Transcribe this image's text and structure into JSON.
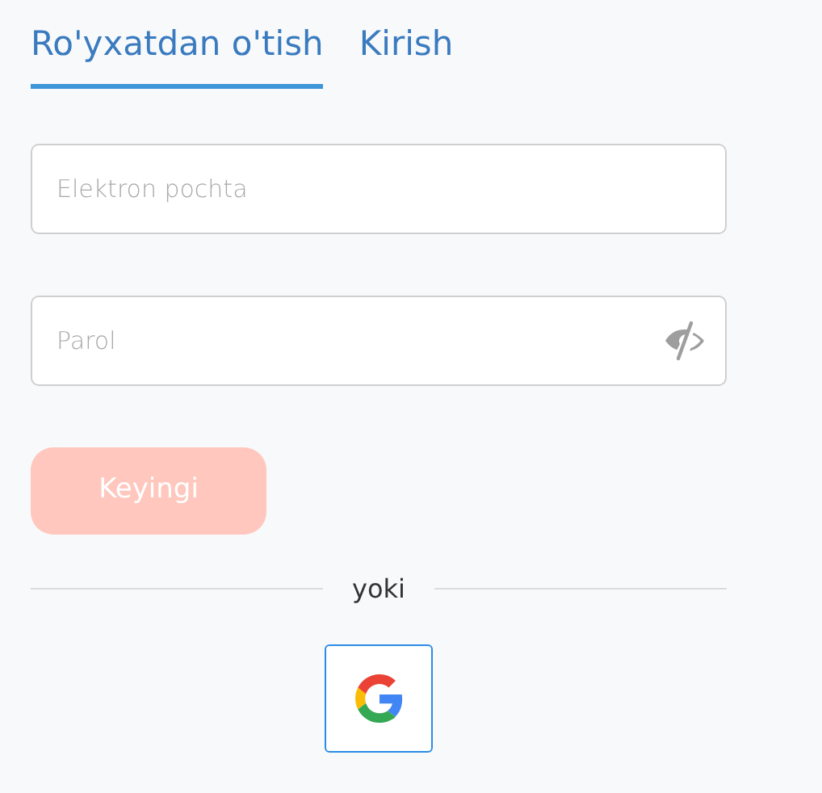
{
  "tabs": [
    {
      "label": "Ro'yxatdan o'tish",
      "selected": true
    },
    {
      "label": "Kirish",
      "selected": false
    }
  ],
  "fields": [
    {
      "kind": "email",
      "placeholder": "Elektron pochta"
    },
    {
      "kind": "password",
      "placeholder": "Parol"
    }
  ],
  "submit": {
    "label": "Keyingi",
    "disabled": true
  },
  "divider": {
    "label": "yoki"
  },
  "social": [
    {
      "kind": "google"
    }
  ]
}
